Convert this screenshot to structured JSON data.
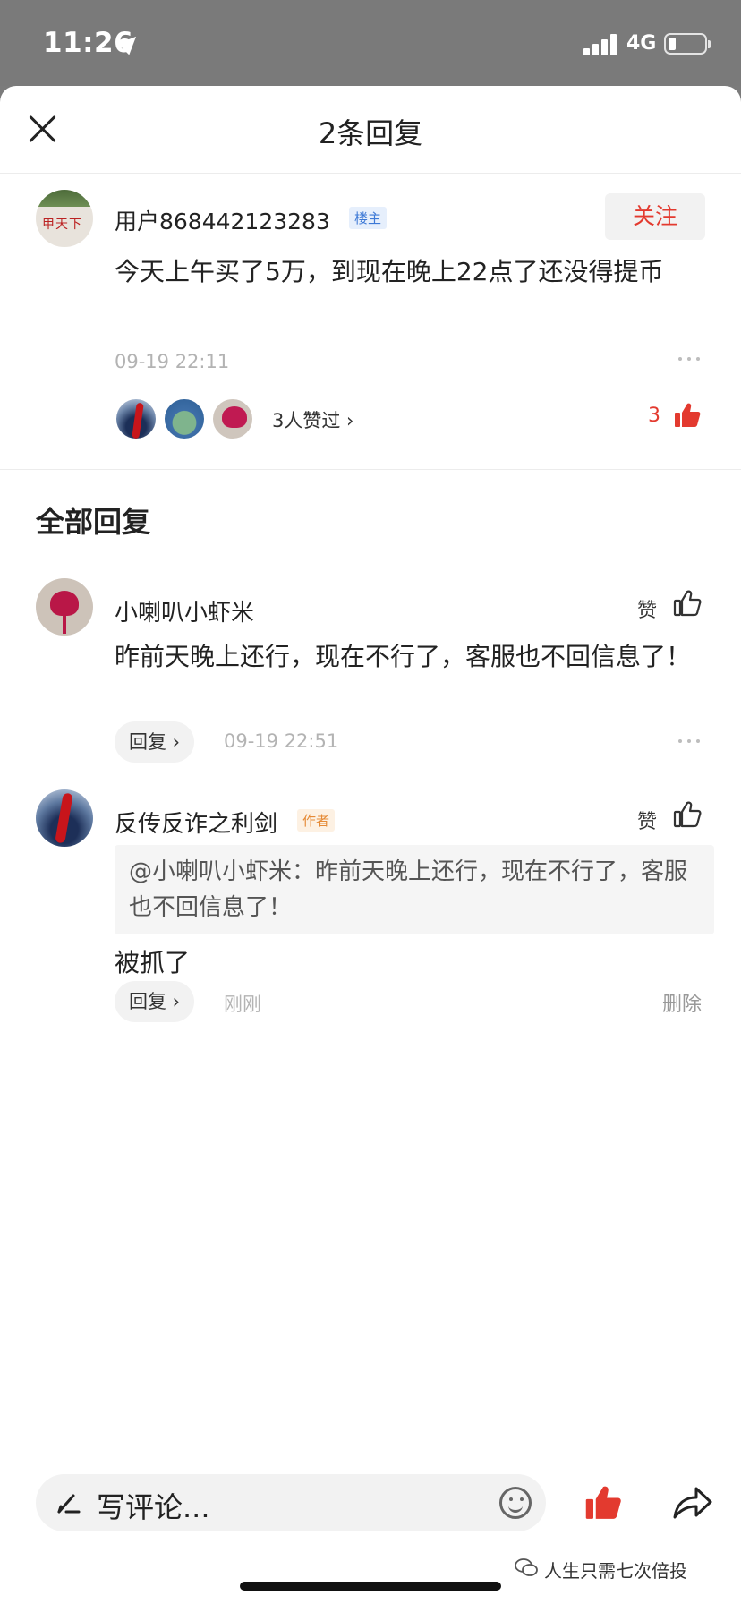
{
  "status_bar": {
    "time": "11:26",
    "network": "4G"
  },
  "header": {
    "title": "2条回复"
  },
  "post": {
    "username": "用户868442123283",
    "owner_badge": "楼主",
    "follow_label": "关注",
    "text": "今天上午买了5万，到现在晚上22点了还没得提币",
    "time": "09-19 22:11",
    "likers_text": "3人赞过 ›",
    "like_count": "3",
    "avatar_text": "甲天下"
  },
  "section_title": "全部回复",
  "replies": [
    {
      "name": "小喇叭小虾米",
      "like_label": "赞",
      "text": "昨前天晚上还行，现在不行了，客服也不回信息了！",
      "reply_label": "回复 ›",
      "time": "09-19 22:51"
    },
    {
      "name": "反传反诈之利剑",
      "badge": "作者",
      "like_label": "赞",
      "quote": "@小喇叭小虾米：昨前天晚上还行，现在不行了，客服也不回信息了！",
      "text": "被抓了",
      "reply_label": "回复 ›",
      "time": "刚刚",
      "delete_label": "删除"
    }
  ],
  "bottom_bar": {
    "placeholder": "写评论...",
    "watermark": "人生只需七次倍投"
  },
  "colors": {
    "accent": "#e33a2f",
    "owner_badge": "#3d79d6",
    "author_badge": "#e58a36"
  }
}
